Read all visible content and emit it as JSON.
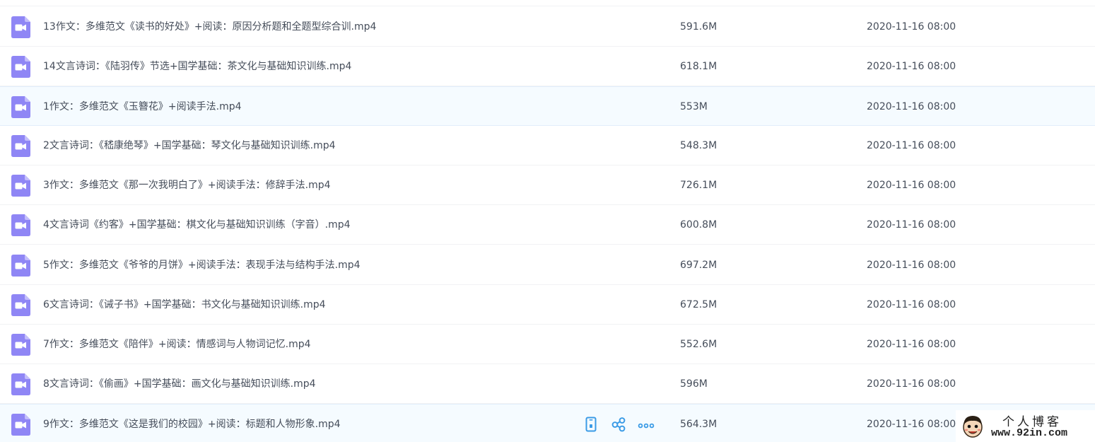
{
  "files": [
    {
      "name": "13作文：多维范文《读书的好处》+阅读：原因分析题和全题型综合训.mp4",
      "size": "591.6M",
      "date": "2020-11-16 08:00"
    },
    {
      "name": "14文言诗词：《陆羽传》节选+国学基础：茶文化与基础知识训练.mp4",
      "size": "618.1M",
      "date": "2020-11-16 08:00"
    },
    {
      "name": "1作文：多维范文《玉簪花》+阅读手法.mp4",
      "size": "553M",
      "date": "2020-11-16 08:00"
    },
    {
      "name": "2文言诗词：《嵇康绝琴》+国学基础：琴文化与基础知识训练.mp4",
      "size": "548.3M",
      "date": "2020-11-16 08:00"
    },
    {
      "name": "3作文：多维范文《那一次我明白了》+阅读手法：修辞手法.mp4",
      "size": "726.1M",
      "date": "2020-11-16 08:00"
    },
    {
      "name": "4文言诗词《约客》+国学基础：棋文化与基础知识训练（字音）.mp4",
      "size": "600.8M",
      "date": "2020-11-16 08:00"
    },
    {
      "name": "5作文：多维范文《爷爷的月饼》+阅读手法：表现手法与结构手法.mp4",
      "size": "697.2M",
      "date": "2020-11-16 08:00"
    },
    {
      "name": "6文言诗词：《诫子书》+国学基础：书文化与基础知识训练.mp4",
      "size": "672.5M",
      "date": "2020-11-16 08:00"
    },
    {
      "name": "7作文：多维范文《陪伴》+阅读：情感词与人物词记忆.mp4",
      "size": "552.6M",
      "date": "2020-11-16 08:00"
    },
    {
      "name": "8文言诗词：《偷画》+国学基础：画文化与基础知识训练.mp4",
      "size": "596M",
      "date": "2020-11-16 08:00"
    },
    {
      "name": "9作文：多维范文《这是我们的校园》+阅读：标题和人物形象.mp4",
      "size": "564.3M",
      "date": "2020-11-16 08:00"
    }
  ],
  "row_actions": [
    "phone-icon",
    "share-icon",
    "more-icon"
  ],
  "icons": {
    "file": "video-file-icon"
  },
  "colors": {
    "icon_purple": "#8f86f5",
    "action_blue": "#3b9be6",
    "highlight_bg": "#f5fbff",
    "text": "#454d5a"
  },
  "watermark": {
    "title": "个人博客",
    "url": "www.92in.com"
  }
}
